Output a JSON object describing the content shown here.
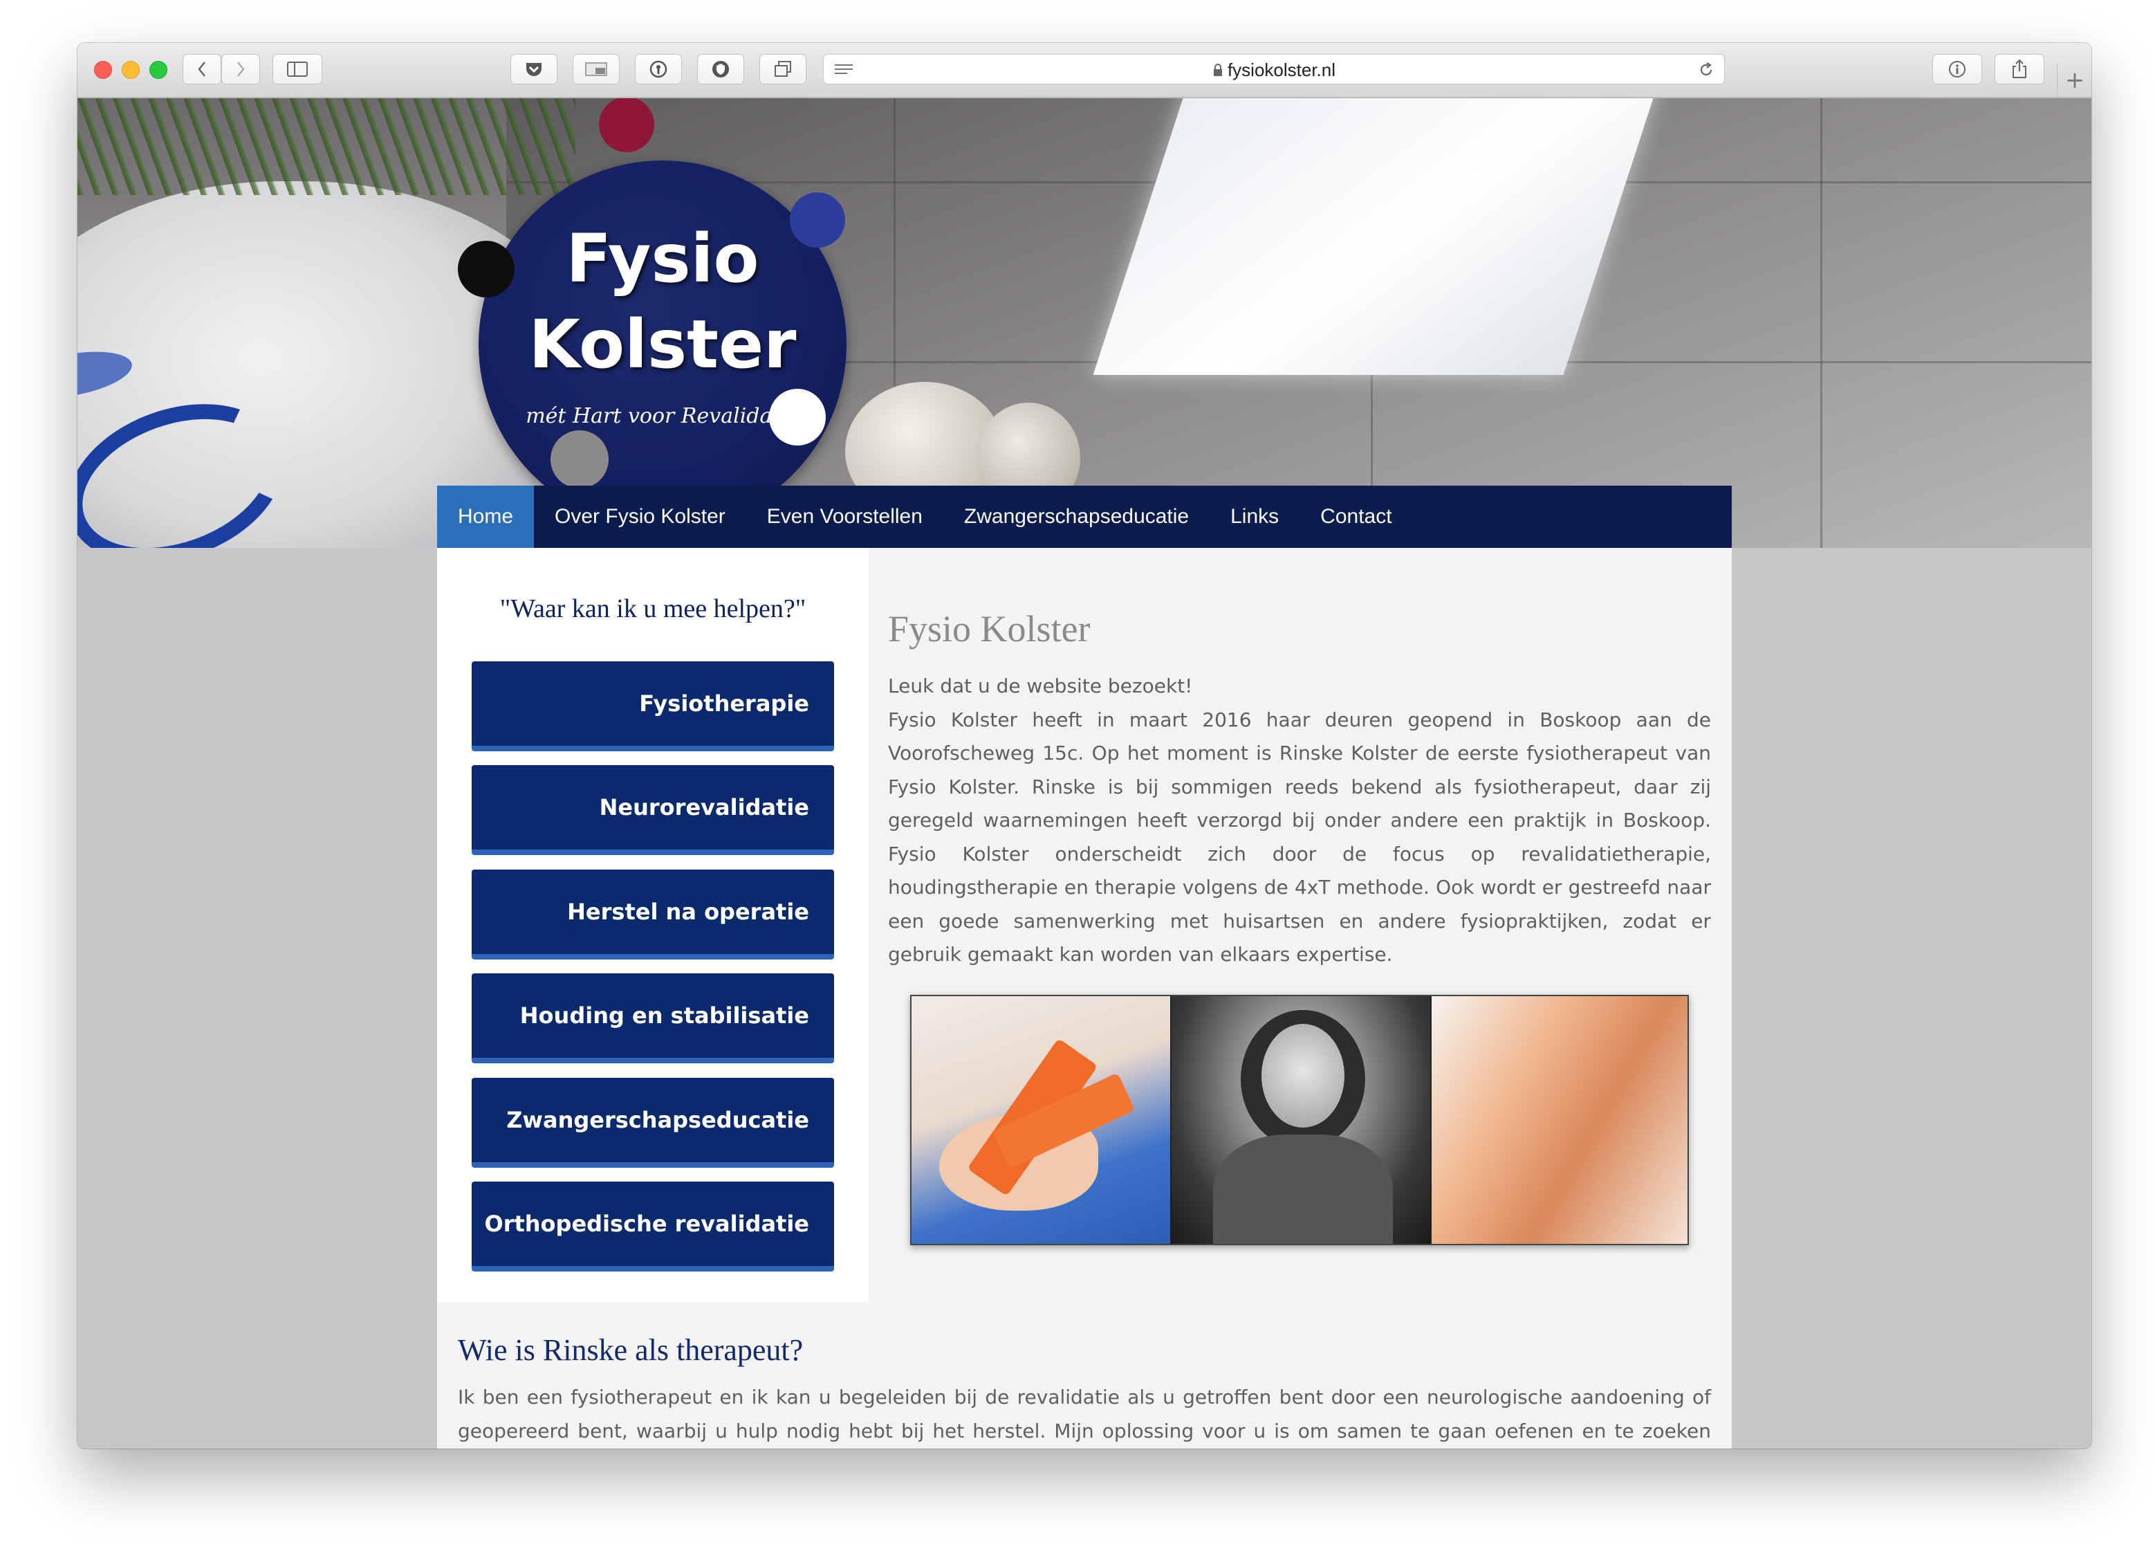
{
  "browser": {
    "url": "fysiokolster.nl"
  },
  "logo": {
    "line1": "Fysio",
    "line2": "Kolster",
    "tagline": "mét Hart voor Revalidatie"
  },
  "nav": {
    "items": [
      {
        "label": "Home",
        "active": true
      },
      {
        "label": "Over Fysio Kolster",
        "active": false
      },
      {
        "label": "Even Voorstellen",
        "active": false
      },
      {
        "label": "Zwangerschapseducatie",
        "active": false
      },
      {
        "label": "Links",
        "active": false
      },
      {
        "label": "Contact",
        "active": false
      }
    ]
  },
  "sidebar": {
    "title": "\"Waar kan ik u mee helpen?\"",
    "buttons": [
      {
        "label": "Fysiotherapie"
      },
      {
        "label": "Neurorevalidatie"
      },
      {
        "label": "Herstel na operatie"
      },
      {
        "label": "Houding en stabilisatie"
      },
      {
        "label": "Zwangerschapseducatie"
      },
      {
        "label": "Orthopedische revalidatie"
      }
    ]
  },
  "main": {
    "title": "Fysio Kolster",
    "greeting": "Leuk dat u de website bezoekt!",
    "body": "Fysio Kolster heeft in maart 2016 haar deuren geopend in Boskoop aan de Voorofscheweg 15c. Op het moment is Rinske Kolster de eerste fysiotherapeut van Fysio Kolster. Rinske is bij sommigen reeds bekend als fysiotherapeut, daar zij geregeld waarnemingen heeft verzorgd bij onder andere een praktijk in Boskoop. Fysio Kolster onderscheidt zich door de focus op revalidatietherapie, houdingstherapie en therapie volgens de 4xT methode. Ook wordt er gestreefd naar een goede samenwerking met huisartsen en andere fysiopraktijken, zodat er gebruik gemaakt kan worden van elkaars expertise."
  },
  "section2": {
    "title": "Wie is Rinske als therapeut?",
    "body": "Ik ben een fysiotherapeut en ik kan u begeleiden bij de revalidatie als u getroffen bent door een neurologische aandoening of geopereerd bent, waarbij u hulp nodig hebt bij het herstel. Mijn oplossing voor u is om samen te gaan oefenen en te zoeken naar de"
  },
  "colors": {
    "nav_bg": "#0b1c4e",
    "nav_active": "#2b6fbb",
    "button_bg": "#0b2a6e",
    "heading_blue": "#102a6d"
  }
}
